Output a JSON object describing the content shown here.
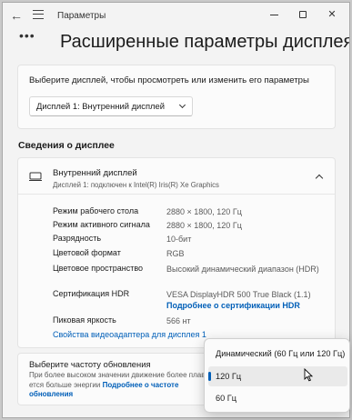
{
  "app": {
    "title": "Параметры"
  },
  "header": {
    "more_label": "•••",
    "page_title": "Расширенные параметры дисплея"
  },
  "display_select": {
    "prompt": "Выберите дисплей, чтобы просмотреть или изменить его параметры",
    "selected": "Дисплей 1: Внутренний дисплей"
  },
  "info": {
    "section_title": "Сведения о дисплее",
    "display_name": "Внутренний дисплей",
    "display_sub": "Дисплей 1: подключен к Intel(R) Iris(R) Xe Graphics",
    "rows": [
      {
        "label": "Режим рабочего стола",
        "value": "2880 × 1800, 120 Гц"
      },
      {
        "label": "Режим активного сигнала",
        "value": "2880 × 1800, 120 Гц"
      },
      {
        "label": "Разрядность",
        "value": "10-бит"
      },
      {
        "label": "Цветовой формат",
        "value": "RGB"
      },
      {
        "label": "Цветовое пространство",
        "value": "Высокий динамический диапазон (HDR)"
      },
      {
        "label": "Сертификация HDR",
        "value": "VESA DisplayHDR 500 True Black (1.1)",
        "link": "Подробнее о сертификации HDR"
      },
      {
        "label": "Пиковая яркость",
        "value": "566 нт"
      }
    ],
    "adapter_link": "Свойства видеоадаптера для дисплея 1"
  },
  "refresh": {
    "title": "Выберите частоту обновления",
    "desc": "При более высоком значении движение более плавн... ется больше энергии",
    "desc_link": "Подробнее о частоте обновления"
  },
  "popup": {
    "options": [
      "Динамический (60 Гц или 120 Гц)",
      "120 Гц",
      "60 Гц"
    ],
    "selected_index": 1
  },
  "colors": {
    "accent": "#005fb8",
    "window_bg": "#f3f3f3",
    "card_bg": "#fbfbfb"
  }
}
